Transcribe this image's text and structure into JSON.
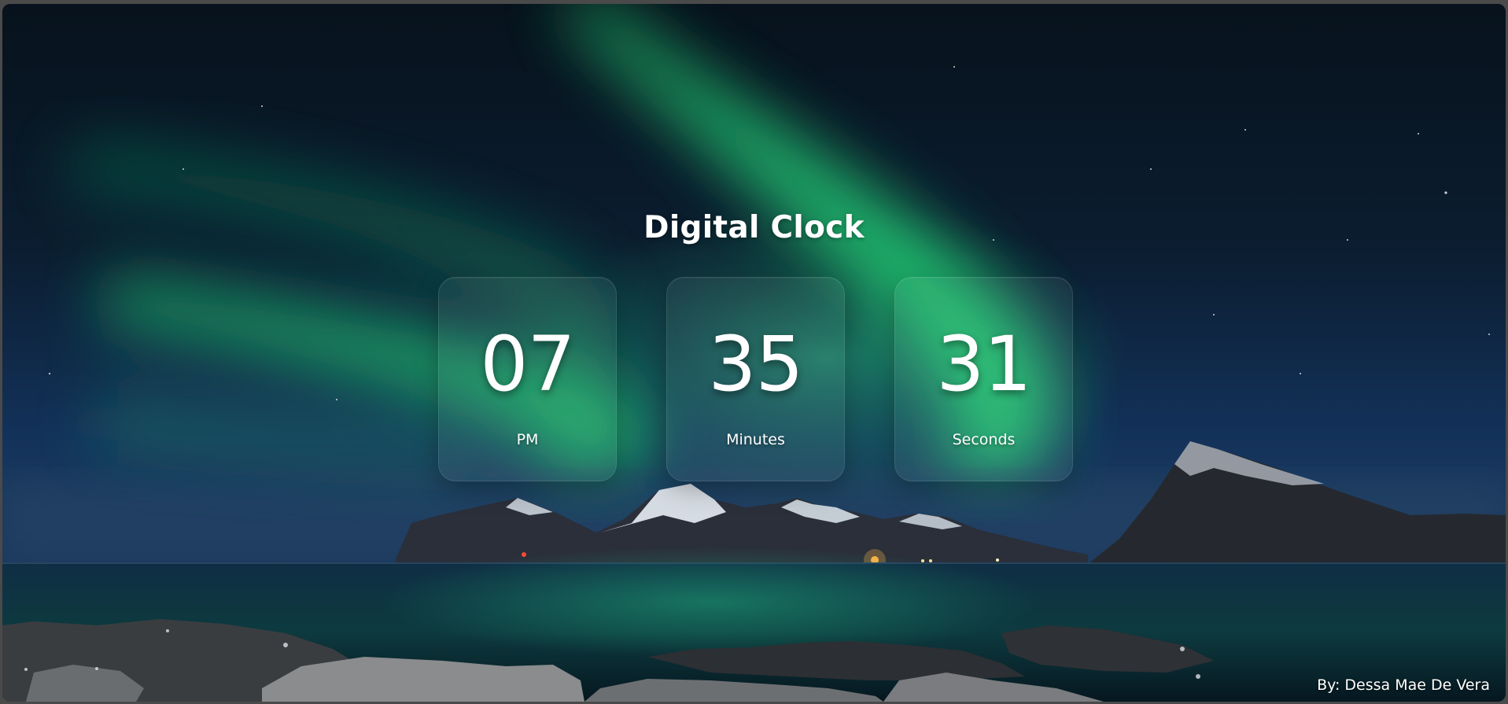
{
  "app": {
    "title": "Digital Clock"
  },
  "clock": {
    "hours": "07",
    "period": "PM",
    "minutes": "35",
    "minutes_label": "Minutes",
    "seconds": "31",
    "seconds_label": "Seconds"
  },
  "footer": {
    "credit": "By: Dessa Mae De Vera"
  },
  "colors": {
    "text": "#ffffff",
    "aurora": "#1fbf6a",
    "sky": "#0b1c33",
    "water": "#0d3a3f"
  }
}
